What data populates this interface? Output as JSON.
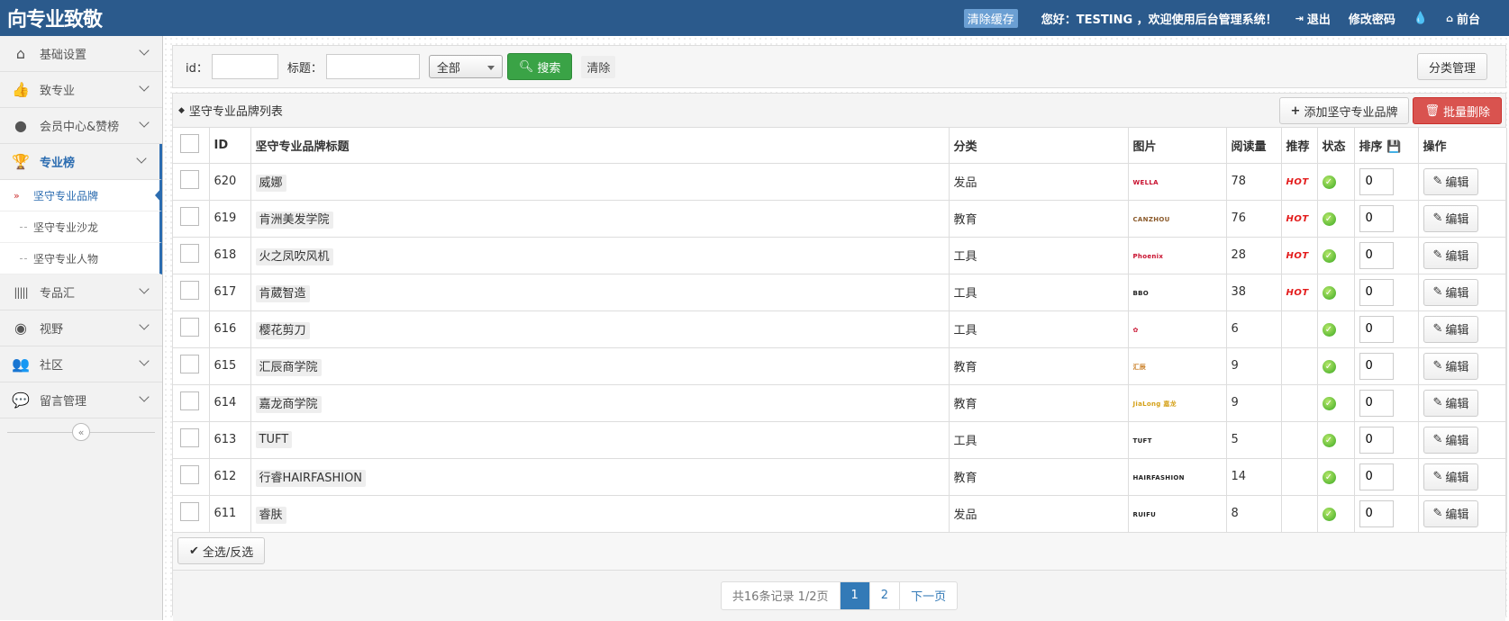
{
  "header": {
    "logo": "向专业致敬",
    "clear_cache": "清除缓存",
    "greeting": "您好：TESTING ，欢迎使用后台管理系统！",
    "logout": "退出",
    "change_password": "修改密码",
    "frontend": "前台"
  },
  "sidebar": {
    "items": [
      {
        "label": "基础设置",
        "icon": "home-icon"
      },
      {
        "label": "致专业",
        "icon": "thumbs-up-icon"
      },
      {
        "label": "会员中心&赞榜",
        "icon": "user-icon"
      },
      {
        "label": "专业榜",
        "icon": "trophy-icon"
      },
      {
        "label": "专品汇",
        "icon": "barcode-icon"
      },
      {
        "label": "视野",
        "icon": "eye-icon"
      },
      {
        "label": "社区",
        "icon": "users-icon"
      },
      {
        "label": "留言管理",
        "icon": "comments-icon"
      }
    ],
    "subitems": [
      {
        "label": "坚守专业品牌"
      },
      {
        "label": "坚守专业沙龙"
      },
      {
        "label": "坚守专业人物"
      }
    ]
  },
  "search": {
    "id_label": "id：",
    "title_label": "标题：",
    "category_selected": "全部",
    "search_button": "搜索",
    "clear_button": "清除",
    "category_manage": "分类管理"
  },
  "panel": {
    "title": "坚守专业品牌列表",
    "add_button": "添加坚守专业品牌",
    "batch_delete": "批量删除"
  },
  "table": {
    "headers": {
      "id": "ID",
      "title": "坚守专业品牌标题",
      "category": "分类",
      "image": "图片",
      "views": "阅读量",
      "recommend": "推荐",
      "status": "状态",
      "sort": "排序",
      "action": "操作"
    },
    "edit_label": "编辑",
    "hot_label": "HOT",
    "rows": [
      {
        "id": "620",
        "title": "威娜",
        "category": "发品",
        "logo": "WELLA",
        "logo_color": "#c8102e",
        "views": "78",
        "hot": true,
        "sort": "0"
      },
      {
        "id": "619",
        "title": "肯洲美发学院",
        "category": "教育",
        "logo": "CANZHOU",
        "logo_color": "#8b5a2b",
        "views": "76",
        "hot": true,
        "sort": "0"
      },
      {
        "id": "618",
        "title": "火之凤吹风机",
        "category": "工具",
        "logo": "Phoenix",
        "logo_color": "#c8102e",
        "views": "28",
        "hot": true,
        "sort": "0"
      },
      {
        "id": "617",
        "title": "肯葳智造",
        "category": "工具",
        "logo": "BBO",
        "logo_color": "#222222",
        "views": "38",
        "hot": true,
        "sort": "0"
      },
      {
        "id": "616",
        "title": "樱花剪刀",
        "category": "工具",
        "logo": "✿",
        "logo_color": "#c8102e",
        "views": "6",
        "hot": false,
        "sort": "0"
      },
      {
        "id": "615",
        "title": "汇辰商学院",
        "category": "教育",
        "logo": "汇辰",
        "logo_color": "#c87a1e",
        "views": "9",
        "hot": false,
        "sort": "0"
      },
      {
        "id": "614",
        "title": "嘉龙商学院",
        "category": "教育",
        "logo": "JiaLong 嘉龙",
        "logo_color": "#d4a017",
        "views": "9",
        "hot": false,
        "sort": "0"
      },
      {
        "id": "613",
        "title": "TUFT",
        "category": "工具",
        "logo": "TUFT",
        "logo_color": "#222222",
        "views": "5",
        "hot": false,
        "sort": "0"
      },
      {
        "id": "612",
        "title": "行睿HAIRFASHION",
        "category": "教育",
        "logo": "HAIRFASHION",
        "logo_color": "#222222",
        "views": "14",
        "hot": false,
        "sort": "0"
      },
      {
        "id": "611",
        "title": "睿肤",
        "category": "发品",
        "logo": "RUIFU",
        "logo_color": "#222222",
        "views": "8",
        "hot": false,
        "sort": "0"
      }
    ]
  },
  "footer": {
    "select_all": "全选/反选",
    "pager_info": "共16条记录 1/2页",
    "pages": [
      "1",
      "2"
    ],
    "current_page": "1",
    "next": "下一页"
  }
}
